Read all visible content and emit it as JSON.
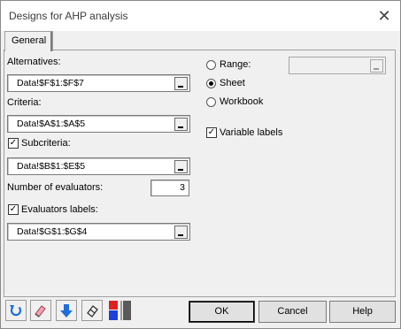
{
  "window": {
    "title": "Designs for AHP analysis",
    "close_glyph": "✕"
  },
  "tabs": [
    {
      "label": "General",
      "active": true
    }
  ],
  "left": {
    "alternatives": {
      "label": "Alternatives:",
      "value": "Data!$F$1:$F$7"
    },
    "criteria": {
      "label": "Criteria:",
      "value": "Data!$A$1:$A$5"
    },
    "subcriteria": {
      "label": "Subcriteria:",
      "checked": true,
      "value": "Data!$B$1:$E$5"
    },
    "evaluators": {
      "label": "Number of evaluators:",
      "value": "3"
    },
    "evaluator_labels": {
      "label": "Evaluators labels:",
      "checked": true,
      "value": "Data!$G$1:$G$4"
    }
  },
  "right": {
    "output_options": [
      {
        "label": "Range:",
        "selected": false
      },
      {
        "label": "Sheet",
        "selected": true
      },
      {
        "label": "Workbook",
        "selected": false
      }
    ],
    "range_value": "",
    "variable_labels": {
      "label": "Variable labels",
      "checked": true
    }
  },
  "buttons": {
    "ok": "OK",
    "cancel": "Cancel",
    "help": "Help"
  },
  "toolbar_icons": [
    "reset-icon",
    "eraser-icon",
    "down-arrow-icon",
    "clear-icon",
    "color-bar-icon"
  ],
  "colors": {
    "accent_blue": "#1e6fd9",
    "red": "#e02020",
    "dark_gray": "#5a5a5a"
  }
}
